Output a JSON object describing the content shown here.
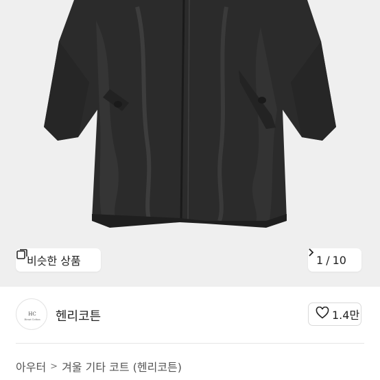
{
  "product_image": {
    "description_icon": "coat-photo",
    "background_color": "#efefef"
  },
  "similar_button": {
    "label": "비슷한 상품",
    "icon": "copy-icon"
  },
  "pager": {
    "current": "1",
    "separator": "/",
    "total": "10",
    "icon": "chevron-right-icon"
  },
  "seller": {
    "name": "헨리코튼",
    "avatar_text": "Henri Cotton"
  },
  "like": {
    "count": "1.4만",
    "icon": "heart-icon"
  },
  "breadcrumb": {
    "items": [
      "아우터",
      "겨울 기타 코트 (헨리코튼)"
    ],
    "separator": ">"
  }
}
